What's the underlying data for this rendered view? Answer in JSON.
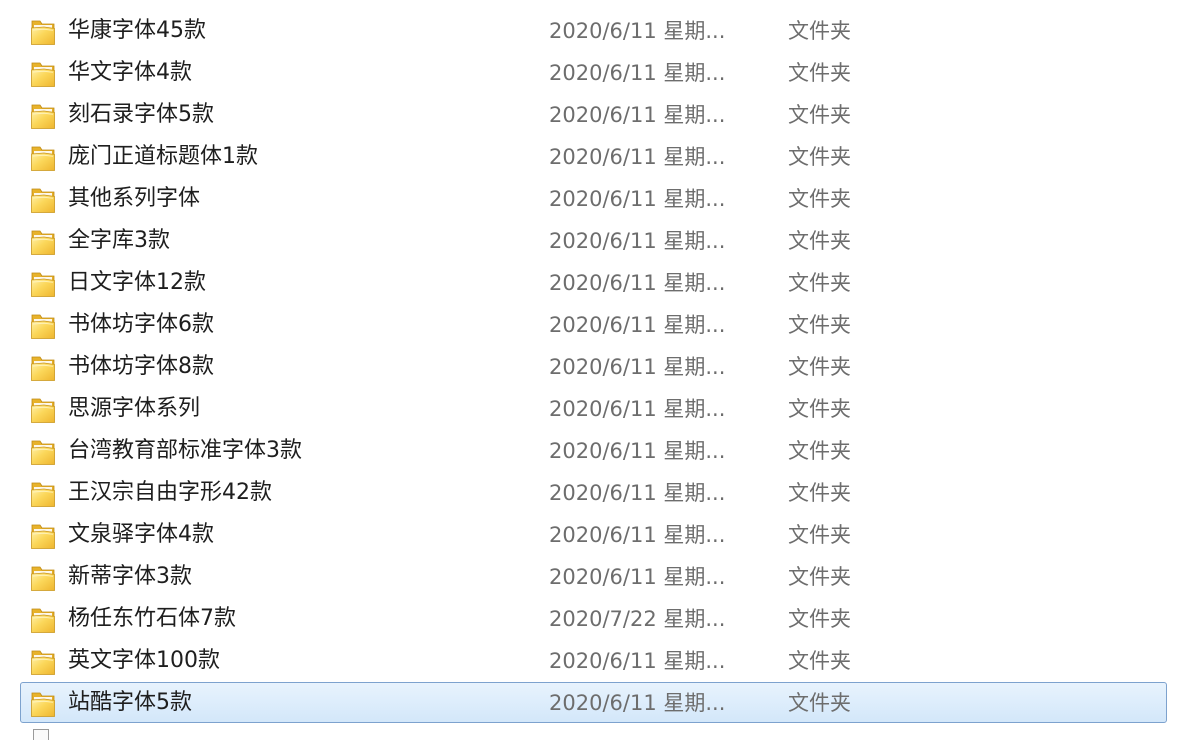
{
  "files": [
    {
      "name": "华康字体45款",
      "date": "2020/6/11 星期...",
      "type": "文件夹",
      "icon": "folder-icon"
    },
    {
      "name": "华文字体4款",
      "date": "2020/6/11 星期...",
      "type": "文件夹",
      "icon": "folder-icon"
    },
    {
      "name": "刻石录字体5款",
      "date": "2020/6/11 星期...",
      "type": "文件夹",
      "icon": "folder-icon"
    },
    {
      "name": "庞门正道标题体1款",
      "date": "2020/6/11 星期...",
      "type": "文件夹",
      "icon": "folder-icon"
    },
    {
      "name": "其他系列字体",
      "date": "2020/6/11 星期...",
      "type": "文件夹",
      "icon": "folder-icon"
    },
    {
      "name": "全字库3款",
      "date": "2020/6/11 星期...",
      "type": "文件夹",
      "icon": "folder-icon"
    },
    {
      "name": "日文字体12款",
      "date": "2020/6/11 星期...",
      "type": "文件夹",
      "icon": "folder-icon"
    },
    {
      "name": "书体坊字体6款",
      "date": "2020/6/11 星期...",
      "type": "文件夹",
      "icon": "folder-icon"
    },
    {
      "name": "书体坊字体8款",
      "date": "2020/6/11 星期...",
      "type": "文件夹",
      "icon": "folder-icon"
    },
    {
      "name": "思源字体系列",
      "date": "2020/6/11 星期...",
      "type": "文件夹",
      "icon": "folder-icon"
    },
    {
      "name": "台湾教育部标准字体3款",
      "date": "2020/6/11 星期...",
      "type": "文件夹",
      "icon": "folder-icon"
    },
    {
      "name": "王汉宗自由字形42款",
      "date": "2020/6/11 星期...",
      "type": "文件夹",
      "icon": "folder-icon"
    },
    {
      "name": "文泉驿字体4款",
      "date": "2020/6/11 星期...",
      "type": "文件夹",
      "icon": "folder-icon"
    },
    {
      "name": "新蒂字体3款",
      "date": "2020/6/11 星期...",
      "type": "文件夹",
      "icon": "folder-icon"
    },
    {
      "name": "杨任东竹石体7款",
      "date": "2020/7/22 星期...",
      "type": "文件夹",
      "icon": "folder-icon"
    },
    {
      "name": "英文字体100款",
      "date": "2020/6/11 星期...",
      "type": "文件夹",
      "icon": "folder-icon"
    },
    {
      "name": "站酷字体5款",
      "date": "2020/6/11 星期...",
      "type": "文件夹",
      "icon": "folder-icon",
      "selected": true
    }
  ],
  "colors": {
    "selection_fill": "#d9ebfb",
    "selection_border": "#7da2ce",
    "folder_yellow": "#f3c73f",
    "secondary_text": "#6d6d6d"
  }
}
